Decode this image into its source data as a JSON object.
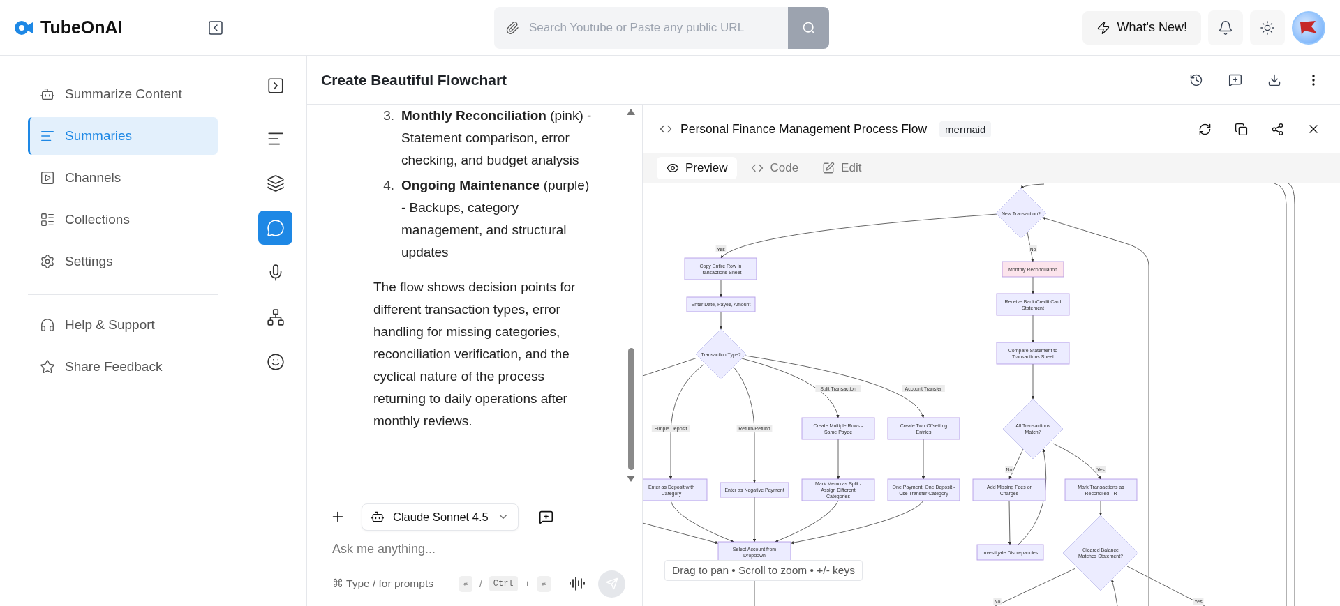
{
  "sidebar": {
    "brand": "TubeOnAI",
    "items": [
      {
        "label": "Summarize Content",
        "selected": false
      },
      {
        "label": "Summaries",
        "selected": true
      },
      {
        "label": "Channels",
        "selected": false
      },
      {
        "label": "Collections",
        "selected": false
      },
      {
        "label": "Settings",
        "selected": false
      }
    ],
    "footer_items": [
      {
        "label": "Help & Support"
      },
      {
        "label": "Share Feedback"
      }
    ]
  },
  "header": {
    "search": {
      "placeholder": "Search Youtube or Paste any public URL"
    },
    "whats_new": "What's New!"
  },
  "rail": {
    "items": [
      {
        "selected": false
      },
      {
        "selected": false
      },
      {
        "selected": false
      },
      {
        "selected": true
      },
      {
        "selected": false
      },
      {
        "selected": false
      },
      {
        "selected": false
      }
    ]
  },
  "page": {
    "title": "Create Beautiful Flowchart"
  },
  "chat": {
    "list": [
      {
        "number": "3.",
        "text": "**Monthly Reconciliation** (pink) - Statement comparison, error checking, and budget analysis"
      },
      {
        "number": "4.",
        "text": "**Ongoing Maintenance** (purple) - Backups, category management, and structural updates"
      }
    ],
    "paragraph": "The flow shows decision points for different transaction types, error handling for missing categories, reconciliation verification, and the cyclical nature of the process returning to daily operations after monthly reviews.",
    "composer": {
      "model": "Claude Sonnet 4.5",
      "placeholder": "Ask me anything...",
      "hint": "⌘ Type / for prompts",
      "shortcuts": [
        {
          "kind": "key",
          "text": "⏎"
        },
        {
          "kind": "sep",
          "text": "/"
        },
        {
          "kind": "key",
          "text": "Ctrl"
        },
        {
          "kind": "sep",
          "text": "+"
        },
        {
          "kind": "key",
          "text": "⏎"
        }
      ]
    }
  },
  "artifact": {
    "title": "Personal Finance Management Process Flow",
    "tag": "mermaid",
    "tabs": [
      {
        "label": "Preview",
        "selected": true
      },
      {
        "label": "Code",
        "selected": false
      },
      {
        "label": "Edit",
        "selected": false
      }
    ],
    "diagram": {
      "nodes": [
        {
          "label": "New Transaction?",
          "kind": "decision",
          "color": "#ececff"
        },
        {
          "label": "Copy Entire Row in Transactions Sheet",
          "kind": "process",
          "color": "#ececff"
        },
        {
          "label": "Monthly Reconciliation",
          "kind": "process",
          "color": "#fce4ec"
        },
        {
          "label": "Enter Date, Payee, Amount",
          "kind": "process",
          "color": "#ececff"
        },
        {
          "label": "Receive Bank/Credit Card Statement",
          "kind": "process",
          "color": "#ececff"
        },
        {
          "label": "Transaction Type?",
          "kind": "decision",
          "color": "#ececff"
        },
        {
          "label": "Compare Statement to Transactions Sheet",
          "kind": "process",
          "color": "#ececff"
        },
        {
          "label": "Create Multiple Rows - Same Payee",
          "kind": "process",
          "color": "#ececff"
        },
        {
          "label": "Create Two Offsetting Entries",
          "kind": "process",
          "color": "#ececff"
        },
        {
          "label": "All Transactions Match?",
          "kind": "decision",
          "color": "#ececff"
        },
        {
          "label": "Enter as Deposit with Category",
          "kind": "process",
          "color": "#ececff"
        },
        {
          "label": "Enter as Negative Payment",
          "kind": "process",
          "color": "#ececff"
        },
        {
          "label": "Mark Memo as Split - Assign Different Categories",
          "kind": "process",
          "color": "#ececff"
        },
        {
          "label": "One Payment, One Deposit - Use Transfer Category",
          "kind": "process",
          "color": "#ececff"
        },
        {
          "label": "Add Missing Fees or Charges",
          "kind": "process",
          "color": "#ececff"
        },
        {
          "label": "Mark Transactions as Reconciled - R",
          "kind": "process",
          "color": "#ececff"
        },
        {
          "label": "Select Account from Dropdown",
          "kind": "process",
          "color": "#ececff"
        },
        {
          "label": "Investigate Discrepancies",
          "kind": "process",
          "color": "#ececff"
        },
        {
          "label": "Cleared Balance Matches Statement?",
          "kind": "decision",
          "color": "#ececff"
        }
      ],
      "edge_labels": [
        "Yes",
        "No",
        "Split Transaction",
        "Account Transfer",
        "Simple Deposit",
        "Return/Refund",
        "No",
        "Yes",
        "No",
        "Yes"
      ]
    },
    "hint": "Drag to pan • Scroll to zoom • +/- keys"
  }
}
